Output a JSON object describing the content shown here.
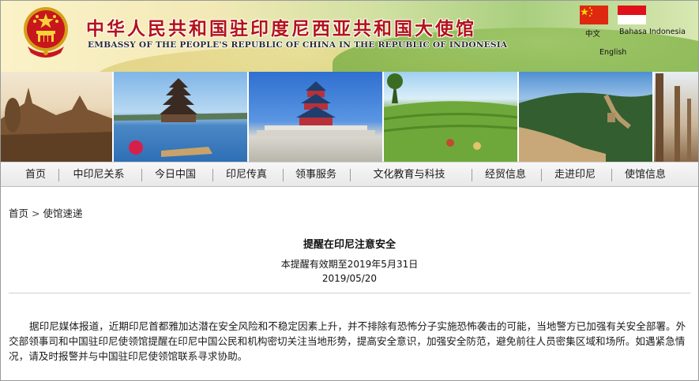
{
  "header": {
    "title_cn": "中华人民共和国驻印度尼西亚共和国大使馆",
    "title_en": "EMBASSY OF THE PEOPLE'S REPUBLIC OF CHINA IN THE REPUBLIC OF INDONESIA",
    "languages": {
      "zh": "中文",
      "id": "Bahasa Indonesia",
      "en": "English"
    }
  },
  "photo_strip": [
    "borobudur-photo",
    "bali-temple-photo",
    "temple-of-heaven-photo",
    "rice-terraces-photo",
    "great-wall-photo",
    "pillars-photo"
  ],
  "nav": {
    "items": [
      "首页",
      "中印尼关系",
      "今日中国",
      "印尼传真",
      "领事服务",
      "文化教育与科技",
      "经贸信息",
      "走进印尼",
      "使馆信息"
    ]
  },
  "breadcrumb": {
    "home": "首页",
    "separator": ">",
    "current": "使馆速递"
  },
  "article": {
    "title": "提醒在印尼注意安全",
    "validity_note": "本提醒有效期至2019年5月31日",
    "date": "2019/05/20",
    "body": "据印尼媒体报道，近期印尼首都雅加达潜在安全风险和不稳定因素上升，并不排除有恐怖分子实施恐怖袭击的可能，当地警方已加强有关安全部署。外交部领事司和中国驻印尼使领馆提醒在印尼中国公民和机构密切关注当地形势，提高安全意识，加强安全防范，避免前往人员密集区域和场所。如遇紧急情况，请及时报警并与中国驻印尼使领馆联系寻求协助。"
  },
  "colors": {
    "title_red": "#b3121a",
    "china_flag": "#de2910",
    "indonesia_flag_red": "#e0111b"
  }
}
